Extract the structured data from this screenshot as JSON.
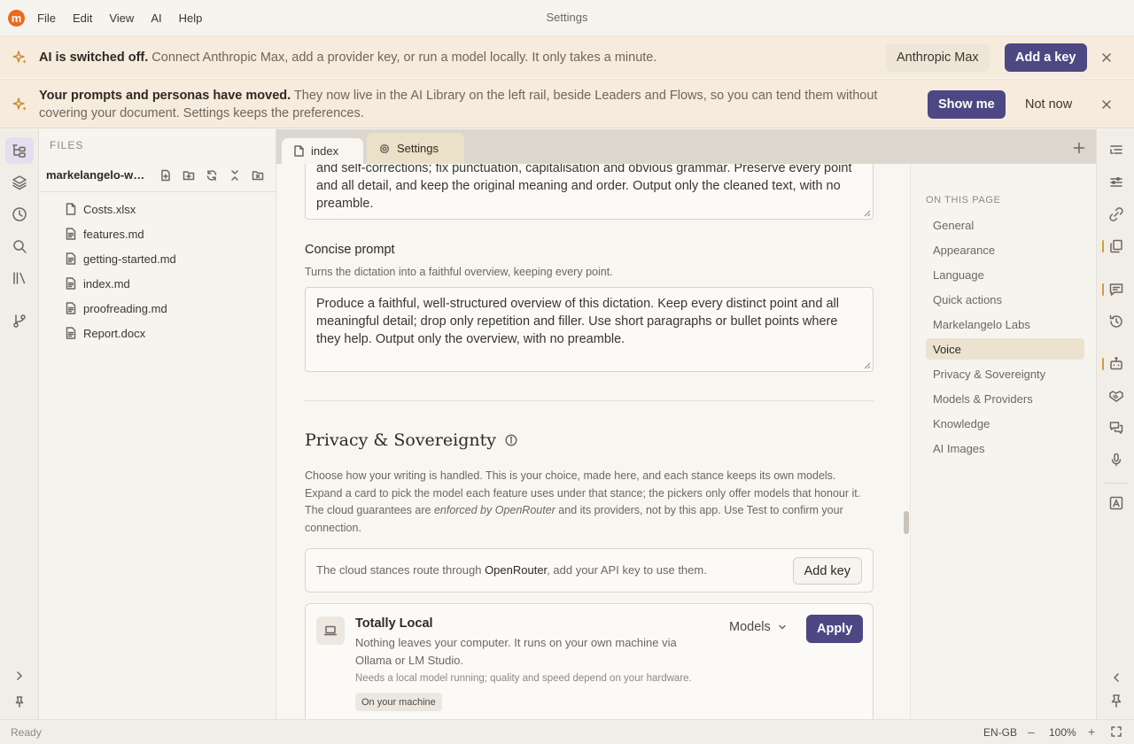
{
  "app": {
    "logo_letter": "m",
    "window_title": "Settings",
    "menu": [
      "File",
      "Edit",
      "View",
      "AI",
      "Help"
    ]
  },
  "banners": {
    "ai_off": {
      "bold": "AI is switched off.",
      "text": " Connect Anthropic Max, add a provider key, or run a model locally. It only takes a minute.",
      "secondary_button": "Anthropic Max",
      "primary_button": "Add a key"
    },
    "moved": {
      "bold": "Your prompts and personas have moved.",
      "text": " They now live in the AI Library on the left rail, beside Leaders and Flows, so you can tend them without covering your document. Settings keeps the preferences.",
      "primary_button": "Show me",
      "secondary_button": "Not now"
    }
  },
  "files": {
    "title": "FILES",
    "workspace": "markelangelo-ws...",
    "items": [
      "Costs.xlsx",
      "features.md",
      "getting-started.md",
      "index.md",
      "proofreading.md",
      "Report.docx"
    ]
  },
  "tabs": [
    {
      "label": "index"
    },
    {
      "label": "Settings"
    }
  ],
  "voice": {
    "clean_prompt_tail": "and self-corrections; fix punctuation, capitalisation and obvious grammar. Preserve every point and all detail, and keep the original meaning and order. Output only the cleaned text, with no preamble.",
    "concise_label": "Concise prompt",
    "concise_help": "Turns the dictation into a faithful overview, keeping every point.",
    "concise_prompt": "Produce a faithful, well-structured overview of this dictation. Keep every distinct point and all meaningful detail; drop only repetition and filler. Use short paragraphs or bullet points where they help. Output only the overview, with no preamble."
  },
  "privacy": {
    "title": "Privacy & Sovereignty",
    "desc_1": "Choose how your writing is handled. This is your choice, made here, and each stance keeps its own models. Expand a card to pick the model each feature uses under that stance; the pickers only offer models that honour it. The cloud guarantees are ",
    "desc_em": "enforced by OpenRouter",
    "desc_2": " and its providers, not by this app. Use Test to confirm your connection.",
    "route_pre": "The cloud stances route through ",
    "route_bold": "OpenRouter",
    "route_post": ", add your API key to use them.",
    "add_key": "Add key",
    "local": {
      "title": "Totally Local",
      "desc": "Nothing leaves your computer. It runs on your own machine via Ollama or LM Studio.",
      "note": "Needs a local model running; quality and speed depend on your hardware.",
      "chip": "On your machine",
      "models": "Models",
      "apply": "Apply"
    }
  },
  "toc": {
    "title": "ON THIS PAGE",
    "items": [
      "General",
      "Appearance",
      "Language",
      "Quick actions",
      "Markelangelo Labs",
      "Voice",
      "Privacy & Sovereignty",
      "Models & Providers",
      "Knowledge",
      "AI Images"
    ],
    "active": "Voice"
  },
  "status": {
    "left": "Ready",
    "language": "EN-GB",
    "zoom": "100%",
    "minus": "–",
    "plus": "+"
  },
  "colors": {
    "accent": "#4d4783",
    "logo": "#ea6a1b",
    "banner": "#f6ebdc",
    "rail_marker": "#d89b3a"
  }
}
